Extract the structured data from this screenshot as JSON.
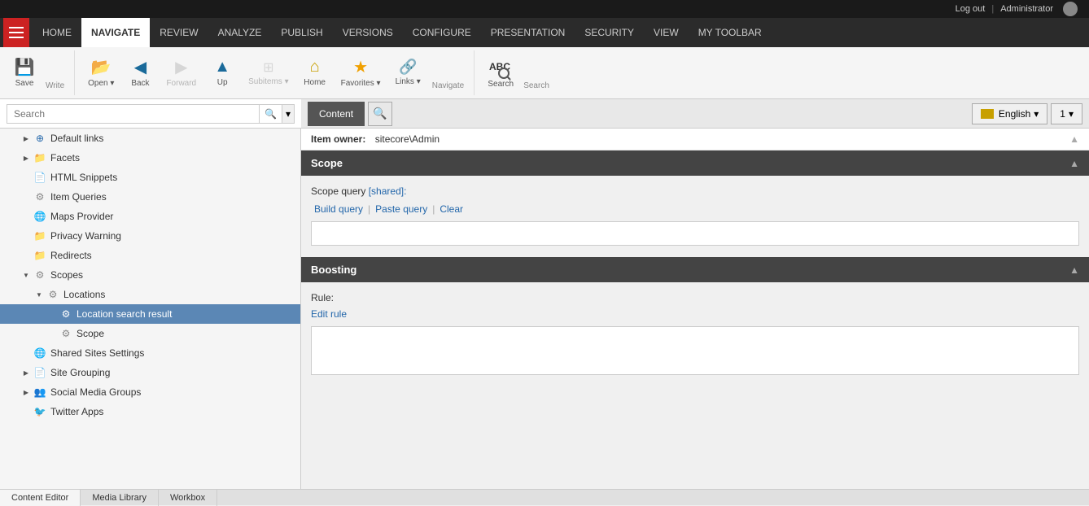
{
  "topbar": {
    "logout": "Log out",
    "separator": "|",
    "username": "Administrator"
  },
  "nav": {
    "items": [
      {
        "label": "HOME",
        "active": false
      },
      {
        "label": "NAVIGATE",
        "active": true
      },
      {
        "label": "REVIEW",
        "active": false
      },
      {
        "label": "ANALYZE",
        "active": false
      },
      {
        "label": "PUBLISH",
        "active": false
      },
      {
        "label": "VERSIONS",
        "active": false
      },
      {
        "label": "CONFIGURE",
        "active": false
      },
      {
        "label": "PRESENTATION",
        "active": false
      },
      {
        "label": "SECURITY",
        "active": false
      },
      {
        "label": "VIEW",
        "active": false
      },
      {
        "label": "MY TOOLBAR",
        "active": false
      }
    ]
  },
  "toolbar": {
    "write_group_label": "Write",
    "navigate_group_label": "Navigate",
    "search_group_label": "Search",
    "save_label": "Save",
    "open_label": "Open",
    "back_label": "Back",
    "forward_label": "Forward",
    "up_label": "Up",
    "subitems_label": "Subitems",
    "home_label": "Home",
    "favorites_label": "Favorites",
    "links_label": "Links",
    "search_label": "Search"
  },
  "search": {
    "placeholder": "Search",
    "value": ""
  },
  "sidebar": {
    "items": [
      {
        "id": "default-links",
        "label": "Default links",
        "indent": 1,
        "indent_class": "indent-2",
        "has_toggle": true,
        "toggle_open": false,
        "icon": "link"
      },
      {
        "id": "facets",
        "label": "Facets",
        "indent": 2,
        "indent_class": "indent-2",
        "has_toggle": true,
        "toggle_open": false,
        "icon": "folder"
      },
      {
        "id": "html-snippets",
        "label": "HTML Snippets",
        "indent": 3,
        "indent_class": "indent-2",
        "has_toggle": false,
        "icon": "doc"
      },
      {
        "id": "item-queries",
        "label": "Item Queries",
        "indent": 3,
        "indent_class": "indent-2",
        "has_toggle": false,
        "icon": "gear"
      },
      {
        "id": "maps-provider",
        "label": "Maps Provider",
        "indent": 3,
        "indent_class": "indent-2",
        "has_toggle": false,
        "icon": "world"
      },
      {
        "id": "privacy-warning",
        "label": "Privacy Warning",
        "indent": 3,
        "indent_class": "indent-2",
        "has_toggle": false,
        "icon": "folder"
      },
      {
        "id": "redirects",
        "label": "Redirects",
        "indent": 3,
        "indent_class": "indent-2",
        "has_toggle": false,
        "icon": "folder"
      },
      {
        "id": "scopes",
        "label": "Scopes",
        "indent": 2,
        "indent_class": "indent-2",
        "has_toggle": true,
        "toggle_open": true,
        "icon": "gear"
      },
      {
        "id": "locations",
        "label": "Locations",
        "indent": 3,
        "indent_class": "indent-3",
        "has_toggle": true,
        "toggle_open": true,
        "icon": "gear"
      },
      {
        "id": "location-search-result",
        "label": "Location search result",
        "indent": 4,
        "indent_class": "indent-4",
        "has_toggle": false,
        "icon": "gear",
        "selected": true
      },
      {
        "id": "scope",
        "label": "Scope",
        "indent": 4,
        "indent_class": "indent-4",
        "has_toggle": false,
        "icon": "gear"
      },
      {
        "id": "shared-sites-settings",
        "label": "Shared Sites Settings",
        "indent": 2,
        "indent_class": "indent-2",
        "has_toggle": false,
        "icon": "world"
      },
      {
        "id": "site-grouping",
        "label": "Site Grouping",
        "indent": 2,
        "indent_class": "indent-2",
        "has_toggle": true,
        "toggle_open": false,
        "icon": "doc"
      },
      {
        "id": "social-media-groups",
        "label": "Social Media Groups",
        "indent": 2,
        "indent_class": "indent-2",
        "has_toggle": true,
        "toggle_open": false,
        "icon": "users"
      },
      {
        "id": "twitter-apps",
        "label": "Twitter Apps",
        "indent": 2,
        "indent_class": "indent-2",
        "has_toggle": false,
        "icon": "twitter"
      }
    ]
  },
  "content": {
    "tab_content": "Content",
    "tab_search_icon": "🔍",
    "toolbar_right": {
      "lang_label": "English",
      "page_label": "1"
    },
    "item_owner_label": "Item owner:",
    "item_owner_value": "sitecore\\Admin",
    "sections": [
      {
        "id": "scope",
        "title": "Scope",
        "collapsed": false,
        "fields": [
          {
            "type": "scope_query",
            "label": "Scope query",
            "shared_label": "[shared]:",
            "links": [
              "Build query",
              "Paste query",
              "Clear"
            ]
          }
        ]
      },
      {
        "id": "boosting",
        "title": "Boosting",
        "collapsed": false,
        "fields": [
          {
            "type": "rule",
            "label": "Rule:",
            "edit_label": "Edit rule"
          }
        ]
      }
    ]
  },
  "bottom_tabs": [
    {
      "label": "Content Editor",
      "active": true
    },
    {
      "label": "Media Library",
      "active": false
    },
    {
      "label": "Workbox",
      "active": false
    }
  ]
}
